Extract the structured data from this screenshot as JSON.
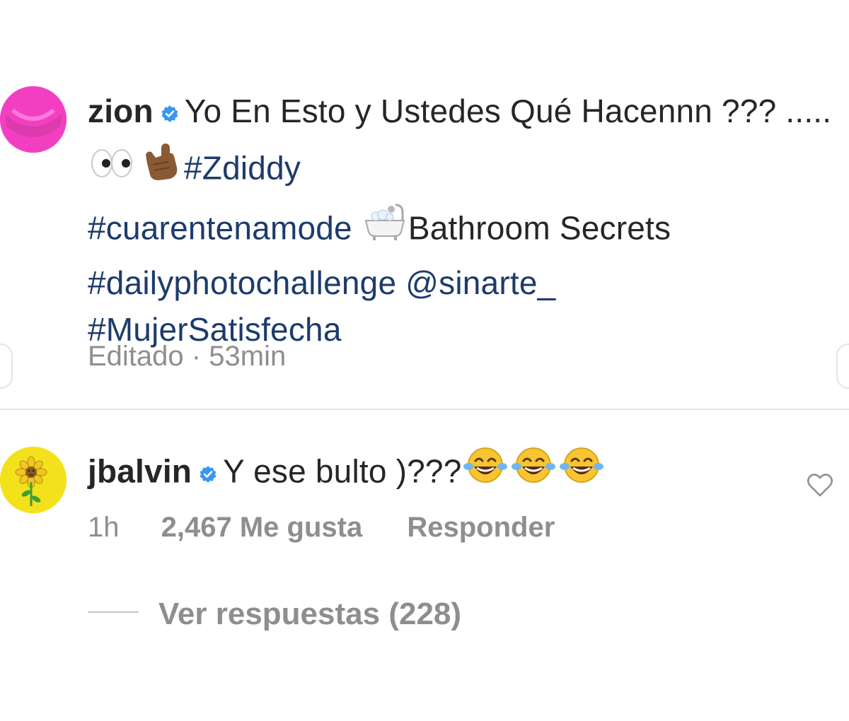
{
  "caption_comment": {
    "username": "zion",
    "text_1": "Yo En Esto y Ustedes Qué Hacennn ??? .....",
    "tag_1": "#Zdiddy",
    "tag_2": "#cuarentenamode",
    "text_2": "Bathroom Secrets",
    "tag_3": "#dailyphotochallenge",
    "mention": "@sinarte_",
    "tag_4": "#MujerSatisfecha",
    "edited_label": "Editado",
    "separator": "·",
    "time": "53min"
  },
  "reply_comment": {
    "username": "jbalvin",
    "text": "Y ese bulto )???",
    "time": "1h",
    "likes": "2,467 Me gusta",
    "reply_label": "Responder"
  },
  "view_replies": {
    "label": "Ver respuestas (228)"
  },
  "colors": {
    "hashtag": "#1d3b6b",
    "verified": "#3897f0",
    "secondary_text": "#8e8e8e",
    "zion_avatar": "#f23fc2",
    "jbalvin_avatar": "#f3e21b"
  },
  "icons": {
    "verified": "verified-badge-icon",
    "heart": "heart-outline-icon",
    "eyes": "eyes-emoji",
    "hand": "call-me-hand-emoji",
    "bathtub": "bathtub-emoji",
    "laugh": "tears-of-joy-emoji"
  }
}
